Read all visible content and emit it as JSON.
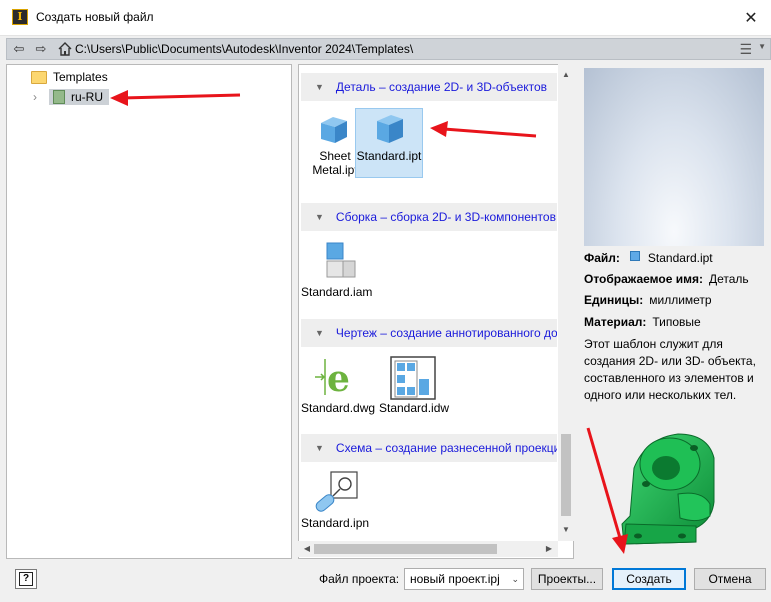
{
  "window": {
    "title": "Создать новый файл",
    "close_glyph": "✕"
  },
  "pathbar": {
    "back_glyph": "⇦",
    "forward_glyph": "⇨",
    "path": "C:\\Users\\Public\\Documents\\Autodesk\\Inventor 2024\\Templates\\",
    "view_glyph": "☰",
    "view_caret": "▼"
  },
  "tree": {
    "root_label": "Templates",
    "child_label": "ru-RU",
    "child_expander": "›"
  },
  "sections": [
    {
      "title": "Деталь – создание 2D- и 3D-объектов",
      "caret": "▼"
    },
    {
      "title": "Сборка – сборка 2D- и 3D-компонентов",
      "caret": "▼"
    },
    {
      "title": "Чертеж – создание аннотированного документа",
      "caret": "▼"
    },
    {
      "title": "Схема – создание разнесенной проекции",
      "caret": "▼"
    }
  ],
  "tiles": {
    "sheet_metal": "Sheet\nMetal.ipt",
    "standard_ipt": "Standard.ipt",
    "standard_iam": "Standard.iam",
    "standard_dwg": "Standard.dwg",
    "standard_idw": "Standard.idw",
    "standard_ipn": "Standard.ipn"
  },
  "scroll": {
    "up": "▲",
    "down": "▼",
    "left": "◀",
    "right": "▶"
  },
  "info": {
    "file_label": "Файл:",
    "file_value": "Standard.ipt",
    "display_name_label": "Отображаемое имя:",
    "display_name_value": "Деталь",
    "units_label": "Единицы:",
    "units_value": "миллиметр",
    "material_label": "Материал:",
    "material_value": "Типовые",
    "description": "Этот шаблон служит для создания 2D- или 3D- объекта, составленного из элементов и одного или нескольких тел."
  },
  "bottom": {
    "help_glyph": "?",
    "project_label": "Файл проекта:",
    "project_value": "новый проект.ipj",
    "project_caret": "⌄",
    "projects_button": "Проекты...",
    "create_button": "Создать",
    "cancel_button": "Отмена"
  },
  "colors": {
    "annotation_arrow": "#e8141b",
    "link_text": "#1a1adb",
    "selection": "#cce4f7",
    "primary_button_border": "#0078d7",
    "part_green": "#14b14a"
  }
}
